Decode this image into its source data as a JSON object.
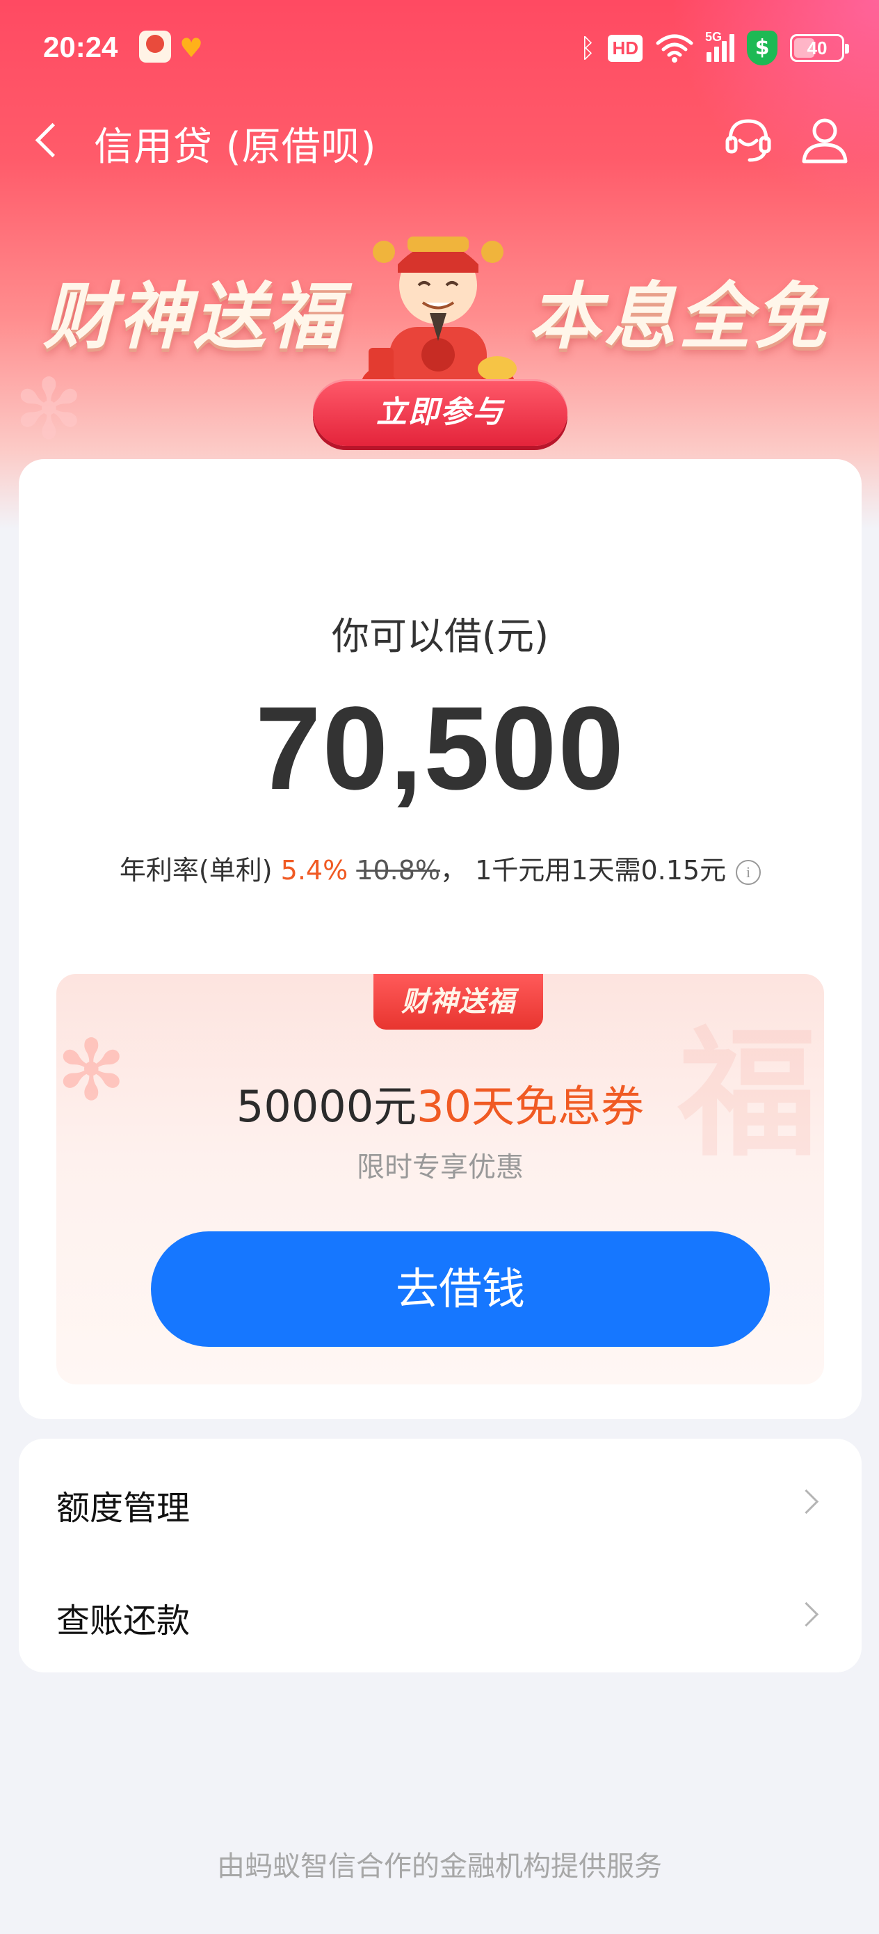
{
  "status_bar": {
    "time": "20:24",
    "hd_badge": "HD",
    "network": "5G",
    "battery": "40",
    "battery_level": 0.4,
    "icons": [
      "bluetooth-icon",
      "wifi-icon",
      "signal-icon",
      "security-shield-icon",
      "battery-icon"
    ]
  },
  "nav": {
    "title": "信用贷 (原借呗)",
    "icons": [
      "back-arrow-icon",
      "customer-service-icon",
      "user-icon"
    ]
  },
  "banner": {
    "left_text": "财神送福",
    "right_text": "本息全免",
    "button_label": "立即参与"
  },
  "loan": {
    "label": "你可以借(元)",
    "amount": "70,500",
    "rate_prefix": "年利率(单利)",
    "rate": "5.4%",
    "original_rate": "10.8%",
    "rate_suffix": "，  1千元用1天需0.15元",
    "info_glyph": "i"
  },
  "promo": {
    "tag": "财神送福",
    "title_amount": "50000元",
    "title_highlight": "30天免息券",
    "subtitle": "限时专享优惠",
    "button_label": "去借钱"
  },
  "menu": {
    "items": [
      {
        "label": "额度管理"
      },
      {
        "label": "查账还款"
      }
    ]
  },
  "footer": {
    "text": "由蚂蚁智信合作的金融机构提供服务"
  },
  "colors": {
    "header_gradient_top": "#ff4a62",
    "accent_orange": "#f05a23",
    "primary_button": "#1677ff",
    "banner_button": "#e4243b",
    "page_background": "#f2f3f8"
  }
}
